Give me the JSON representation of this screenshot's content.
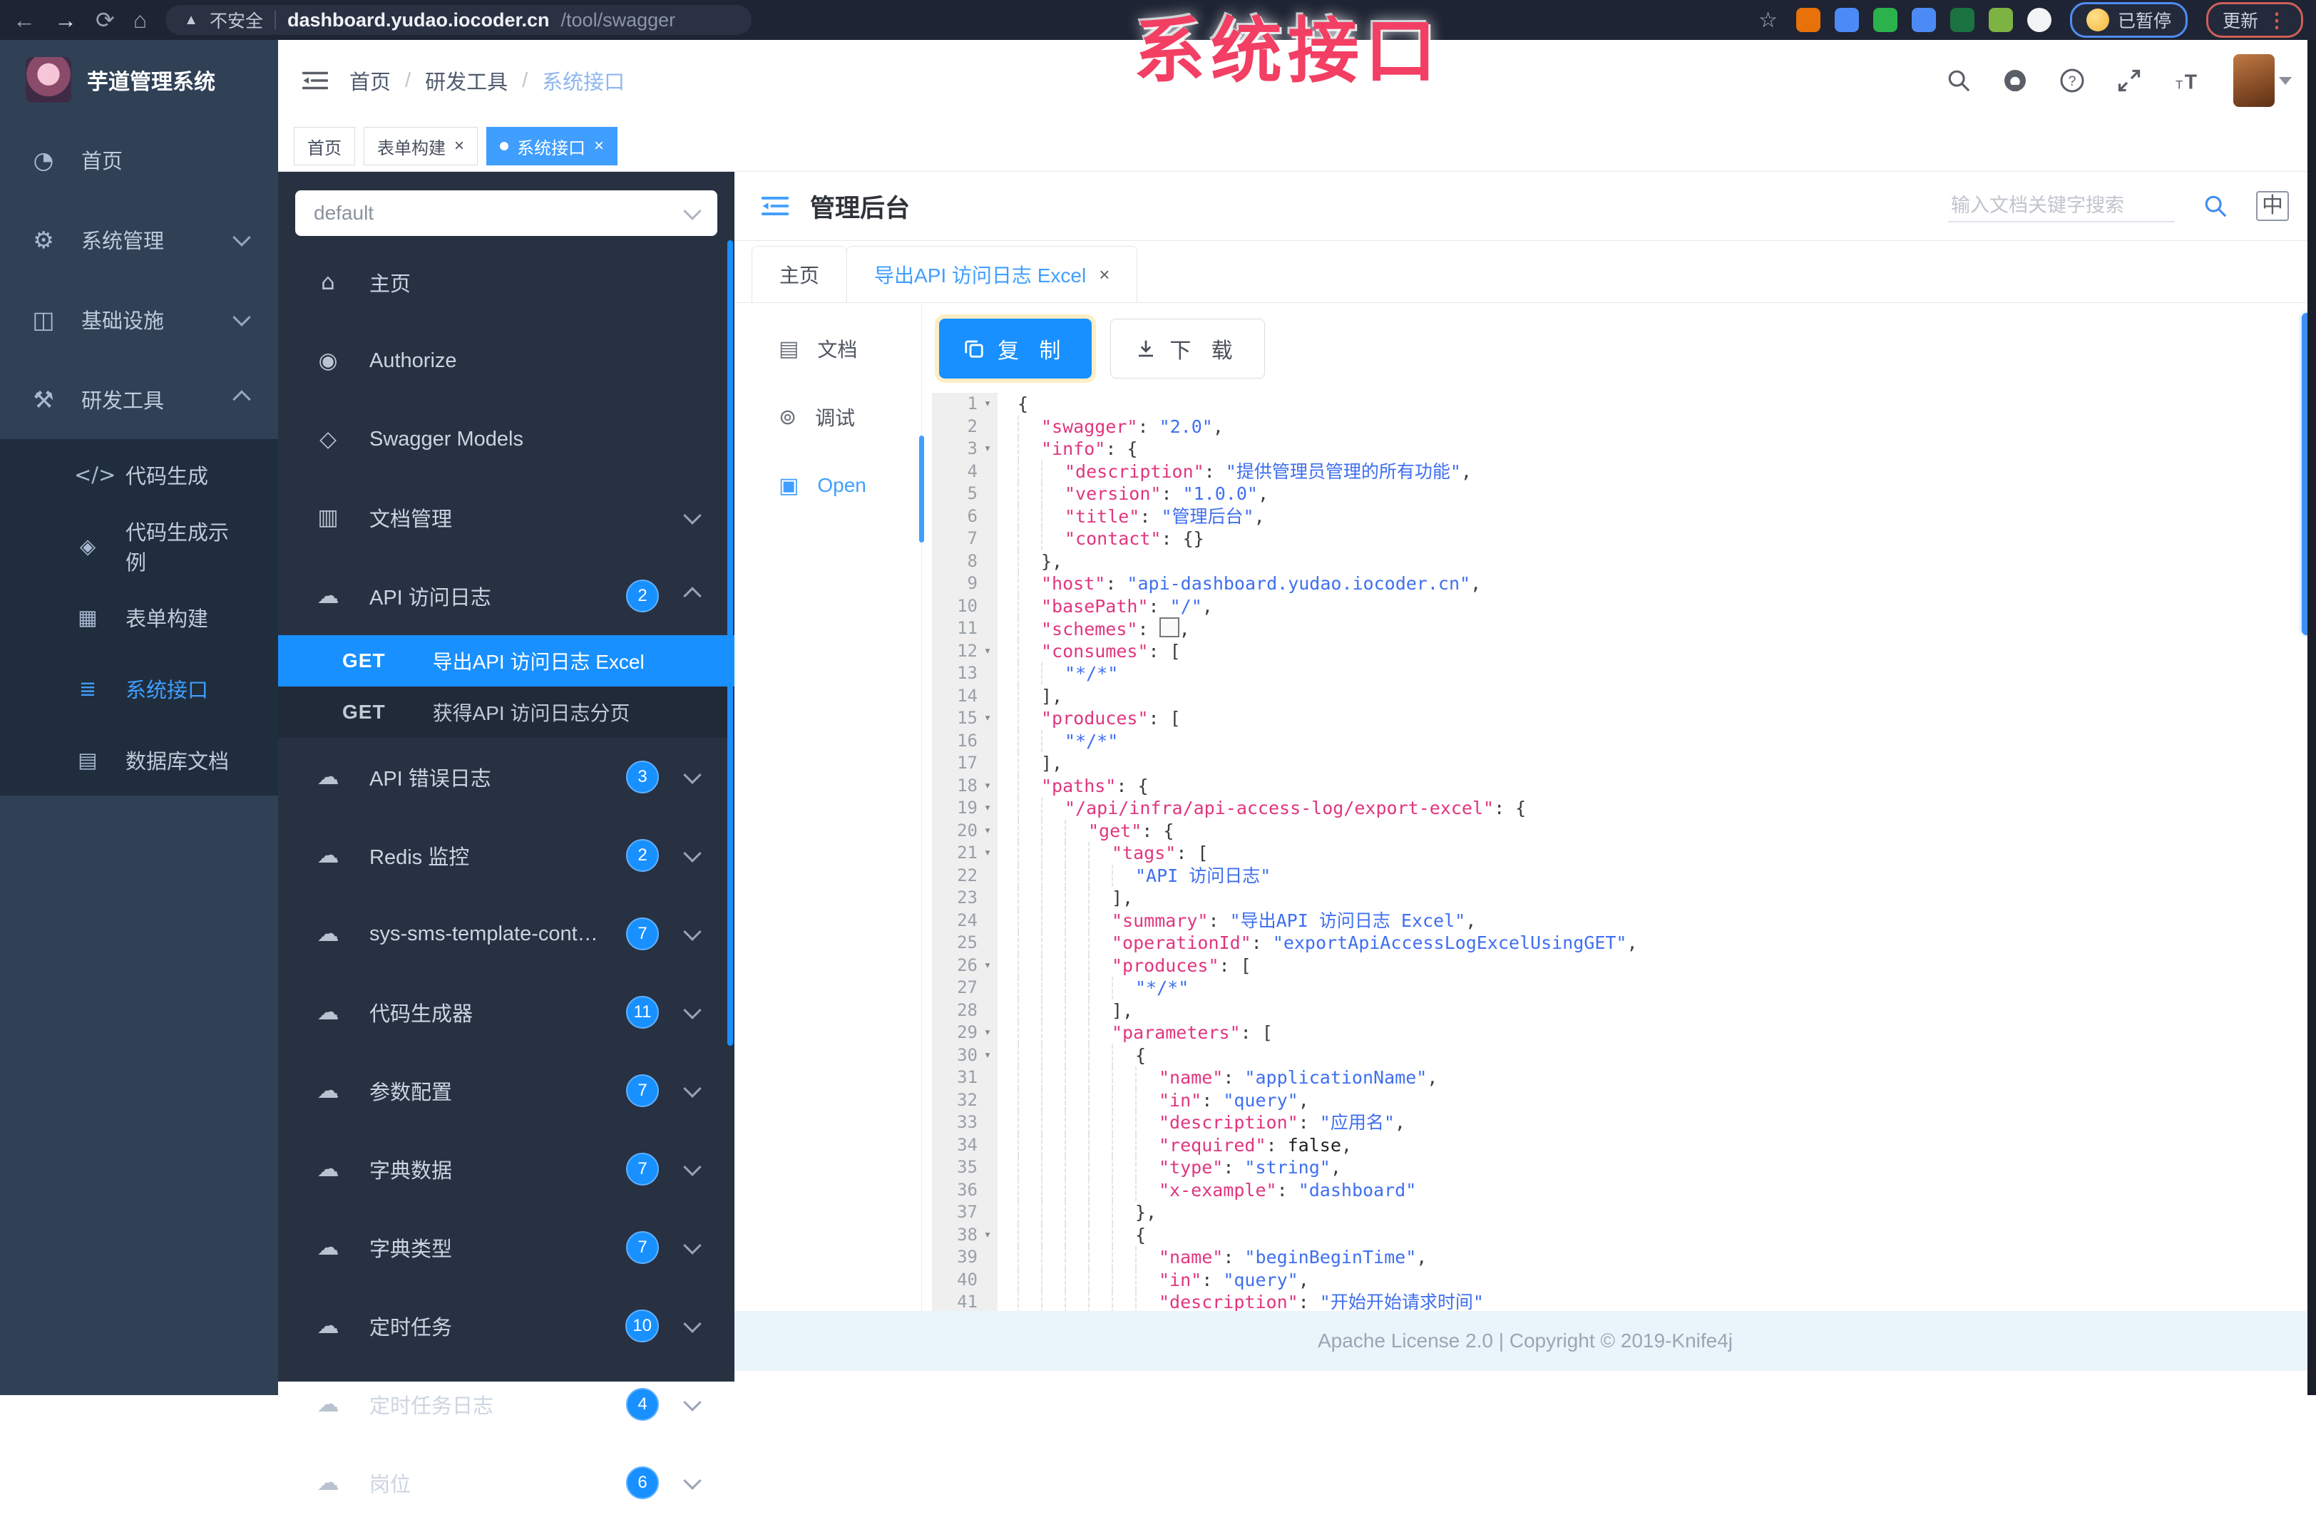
{
  "colors": {
    "accent_blue": "#1890ff",
    "element_blue": "#409eff",
    "watermark_pink": "#f23f63",
    "sidebar_bg": "#304156",
    "k_sidebar_bg": "#273142"
  },
  "browser": {
    "security_label": "不安全",
    "url_host": "dashboard.yudao.iocoder.cn",
    "url_path": "/tool/swagger",
    "paused_badge": "已暂停",
    "update_button": "更新",
    "extension_colors": [
      "#e8710a",
      "#4c8bf5",
      "#2bb24c",
      "#4c8bf5",
      "#1a7340",
      "#7cb342",
      "#f1f3f4"
    ]
  },
  "watermark": "系统接口",
  "sidebar": {
    "app_title": "芋道管理系统",
    "items": [
      {
        "label": "首页",
        "icon": "dashboard-icon"
      },
      {
        "label": "系统管理",
        "icon": "gear-icon",
        "chevron": "down"
      },
      {
        "label": "基础设施",
        "icon": "infra-icon",
        "chevron": "down"
      },
      {
        "label": "研发工具",
        "icon": "tools-icon",
        "chevron": "up"
      }
    ],
    "submenu": [
      {
        "label": "代码生成",
        "icon": "code-icon"
      },
      {
        "label": "代码生成示例",
        "icon": "shield-icon"
      },
      {
        "label": "表单构建",
        "icon": "form-icon"
      },
      {
        "label": "系统接口",
        "icon": "api-icon",
        "active": true
      },
      {
        "label": "数据库文档",
        "icon": "database-icon"
      }
    ]
  },
  "header": {
    "breadcrumb": [
      "首页",
      "研发工具",
      "系统接口"
    ],
    "icons": [
      "search-icon",
      "github-icon",
      "help-icon",
      "fullscreen-icon",
      "font-size-icon"
    ]
  },
  "page_tags": [
    {
      "label": "首页",
      "closable": false,
      "active": false
    },
    {
      "label": "表单构建",
      "closable": true,
      "active": false
    },
    {
      "label": "系统接口",
      "closable": true,
      "active": true
    }
  ],
  "k_sidebar": {
    "group_select_value": "default",
    "items": [
      {
        "label": "主页",
        "icon": "home-icon"
      },
      {
        "label": "Authorize",
        "icon": "lock-icon"
      },
      {
        "label": "Swagger Models",
        "icon": "models-icon"
      },
      {
        "label": "文档管理",
        "icon": "doc-icon",
        "chevron": "down"
      },
      {
        "label": "API 访问日志",
        "icon": "cloud-icon",
        "badge": "2",
        "chevron": "up"
      }
    ],
    "api_rows": [
      {
        "method": "GET",
        "label": "导出API 访问日志 Excel",
        "active": true
      },
      {
        "method": "GET",
        "label": "获得API 访问日志分页",
        "active": false
      }
    ],
    "groups": [
      {
        "label": "API 错误日志",
        "badge": "3"
      },
      {
        "label": "Redis 监控",
        "badge": "2"
      },
      {
        "label": "sys-sms-template-controller",
        "badge": "7"
      },
      {
        "label": "代码生成器",
        "badge": "11"
      },
      {
        "label": "参数配置",
        "badge": "7"
      },
      {
        "label": "字典数据",
        "badge": "7"
      },
      {
        "label": "字典类型",
        "badge": "7"
      },
      {
        "label": "定时任务",
        "badge": "10"
      },
      {
        "label": "定时任务日志",
        "badge": "4"
      },
      {
        "label": "岗位",
        "badge": "6"
      }
    ]
  },
  "k_main": {
    "title": "管理后台",
    "search_placeholder": "输入文档关键字搜索",
    "lang_label": "中",
    "doc_tabs": [
      {
        "label": "主页",
        "closable": false,
        "active": false
      },
      {
        "label": "导出API 访问日志 Excel",
        "closable": true,
        "active": true
      }
    ],
    "mini_menu": [
      {
        "label": "文档",
        "icon": "doc-lines-icon",
        "active": false
      },
      {
        "label": "调试",
        "icon": "bug-icon",
        "active": false
      },
      {
        "label": "Open",
        "icon": "open-file-icon",
        "active": true
      }
    ],
    "copy_label": "复 制",
    "download_label": "下 载",
    "footer": "Apache License 2.0 | Copyright © 2019-Knife4j"
  },
  "code": {
    "lines": [
      {
        "n": 1,
        "f": 1,
        "i": 0,
        "t": [
          [
            "p",
            "{"
          ]
        ]
      },
      {
        "n": 2,
        "i": 1,
        "t": [
          [
            "k",
            "\"swagger\""
          ],
          [
            "p",
            ": "
          ],
          [
            "s",
            "\"2.0\""
          ],
          [
            "p",
            ","
          ]
        ]
      },
      {
        "n": 3,
        "f": 1,
        "i": 1,
        "t": [
          [
            "k",
            "\"info\""
          ],
          [
            "p",
            ": {"
          ]
        ]
      },
      {
        "n": 4,
        "i": 2,
        "t": [
          [
            "k",
            "\"description\""
          ],
          [
            "p",
            ": "
          ],
          [
            "s",
            "\"提供管理员管理的所有功能\""
          ],
          [
            "p",
            ","
          ]
        ]
      },
      {
        "n": 5,
        "i": 2,
        "t": [
          [
            "k",
            "\"version\""
          ],
          [
            "p",
            ": "
          ],
          [
            "s",
            "\"1.0.0\""
          ],
          [
            "p",
            ","
          ]
        ]
      },
      {
        "n": 6,
        "i": 2,
        "t": [
          [
            "k",
            "\"title\""
          ],
          [
            "p",
            ": "
          ],
          [
            "s",
            "\"管理后台\""
          ],
          [
            "p",
            ","
          ]
        ]
      },
      {
        "n": 7,
        "i": 2,
        "t": [
          [
            "k",
            "\"contact\""
          ],
          [
            "p",
            ": {}"
          ]
        ]
      },
      {
        "n": 8,
        "i": 1,
        "t": [
          [
            "p",
            "},"
          ]
        ]
      },
      {
        "n": 9,
        "i": 1,
        "t": [
          [
            "k",
            "\"host\""
          ],
          [
            "p",
            ": "
          ],
          [
            "s",
            "\"api-dashboard.yudao.iocoder.cn\""
          ],
          [
            "p",
            ","
          ]
        ]
      },
      {
        "n": 10,
        "i": 1,
        "t": [
          [
            "k",
            "\"basePath\""
          ],
          [
            "p",
            ": "
          ],
          [
            "s",
            "\"/\""
          ],
          [
            "p",
            ","
          ]
        ]
      },
      {
        "n": 11,
        "i": 1,
        "t": [
          [
            "k",
            "\"schemes\""
          ],
          [
            "p",
            ": "
          ],
          [
            "x",
            ""
          ],
          [
            "p",
            ","
          ]
        ]
      },
      {
        "n": 12,
        "f": 1,
        "i": 1,
        "t": [
          [
            "k",
            "\"consumes\""
          ],
          [
            "p",
            ": ["
          ]
        ]
      },
      {
        "n": 13,
        "i": 2,
        "t": [
          [
            "s",
            "\"*/*\""
          ]
        ]
      },
      {
        "n": 14,
        "i": 1,
        "t": [
          [
            "p",
            "],"
          ]
        ]
      },
      {
        "n": 15,
        "f": 1,
        "i": 1,
        "t": [
          [
            "k",
            "\"produces\""
          ],
          [
            "p",
            ": ["
          ]
        ]
      },
      {
        "n": 16,
        "i": 2,
        "t": [
          [
            "s",
            "\"*/*\""
          ]
        ]
      },
      {
        "n": 17,
        "i": 1,
        "t": [
          [
            "p",
            "],"
          ]
        ]
      },
      {
        "n": 18,
        "f": 1,
        "i": 1,
        "t": [
          [
            "k",
            "\"paths\""
          ],
          [
            "p",
            ": {"
          ]
        ]
      },
      {
        "n": 19,
        "f": 1,
        "i": 2,
        "t": [
          [
            "k",
            "\"/api/infra/api-access-log/export-excel\""
          ],
          [
            "p",
            ": {"
          ]
        ]
      },
      {
        "n": 20,
        "f": 1,
        "i": 3,
        "t": [
          [
            "k",
            "\"get\""
          ],
          [
            "p",
            ": {"
          ]
        ]
      },
      {
        "n": 21,
        "f": 1,
        "i": 4,
        "t": [
          [
            "k",
            "\"tags\""
          ],
          [
            "p",
            ": ["
          ]
        ]
      },
      {
        "n": 22,
        "i": 5,
        "t": [
          [
            "s",
            "\"API 访问日志\""
          ]
        ]
      },
      {
        "n": 23,
        "i": 4,
        "t": [
          [
            "p",
            "],"
          ]
        ]
      },
      {
        "n": 24,
        "i": 4,
        "t": [
          [
            "k",
            "\"summary\""
          ],
          [
            "p",
            ": "
          ],
          [
            "s",
            "\"导出API 访问日志 Excel\""
          ],
          [
            "p",
            ","
          ]
        ]
      },
      {
        "n": 25,
        "i": 4,
        "t": [
          [
            "k",
            "\"operationId\""
          ],
          [
            "p",
            ": "
          ],
          [
            "s",
            "\"exportApiAccessLogExcelUsingGET\""
          ],
          [
            "p",
            ","
          ]
        ]
      },
      {
        "n": 26,
        "f": 1,
        "i": 4,
        "t": [
          [
            "k",
            "\"produces\""
          ],
          [
            "p",
            ": ["
          ]
        ]
      },
      {
        "n": 27,
        "i": 5,
        "t": [
          [
            "s",
            "\"*/*\""
          ]
        ]
      },
      {
        "n": 28,
        "i": 4,
        "t": [
          [
            "p",
            "],"
          ]
        ]
      },
      {
        "n": 29,
        "f": 1,
        "i": 4,
        "t": [
          [
            "k",
            "\"parameters\""
          ],
          [
            "p",
            ": ["
          ]
        ]
      },
      {
        "n": 30,
        "f": 1,
        "i": 5,
        "t": [
          [
            "p",
            "{"
          ]
        ]
      },
      {
        "n": 31,
        "i": 6,
        "t": [
          [
            "k",
            "\"name\""
          ],
          [
            "p",
            ": "
          ],
          [
            "s",
            "\"applicationName\""
          ],
          [
            "p",
            ","
          ]
        ]
      },
      {
        "n": 32,
        "i": 6,
        "t": [
          [
            "k",
            "\"in\""
          ],
          [
            "p",
            ": "
          ],
          [
            "s",
            "\"query\""
          ],
          [
            "p",
            ","
          ]
        ]
      },
      {
        "n": 33,
        "i": 6,
        "t": [
          [
            "k",
            "\"description\""
          ],
          [
            "p",
            ": "
          ],
          [
            "s",
            "\"应用名\""
          ],
          [
            "p",
            ","
          ]
        ]
      },
      {
        "n": 34,
        "i": 6,
        "t": [
          [
            "k",
            "\"required\""
          ],
          [
            "p",
            ": "
          ],
          [
            "b",
            "false"
          ],
          [
            "p",
            ","
          ]
        ]
      },
      {
        "n": 35,
        "i": 6,
        "t": [
          [
            "k",
            "\"type\""
          ],
          [
            "p",
            ": "
          ],
          [
            "s",
            "\"string\""
          ],
          [
            "p",
            ","
          ]
        ]
      },
      {
        "n": 36,
        "i": 6,
        "t": [
          [
            "k",
            "\"x-example\""
          ],
          [
            "p",
            ": "
          ],
          [
            "s",
            "\"dashboard\""
          ]
        ]
      },
      {
        "n": 37,
        "i": 5,
        "t": [
          [
            "p",
            "},"
          ]
        ]
      },
      {
        "n": 38,
        "f": 1,
        "i": 5,
        "t": [
          [
            "p",
            "{"
          ]
        ]
      },
      {
        "n": 39,
        "i": 6,
        "t": [
          [
            "k",
            "\"name\""
          ],
          [
            "p",
            ": "
          ],
          [
            "s",
            "\"beginBeginTime\""
          ],
          [
            "p",
            ","
          ]
        ]
      },
      {
        "n": 40,
        "i": 6,
        "t": [
          [
            "k",
            "\"in\""
          ],
          [
            "p",
            ": "
          ],
          [
            "s",
            "\"query\""
          ],
          [
            "p",
            ","
          ]
        ]
      },
      {
        "n": 41,
        "i": 6,
        "t": [
          [
            "k",
            "\"description\""
          ],
          [
            "p",
            ": "
          ],
          [
            "s",
            "\"开始开始请求时间\""
          ]
        ]
      }
    ]
  }
}
